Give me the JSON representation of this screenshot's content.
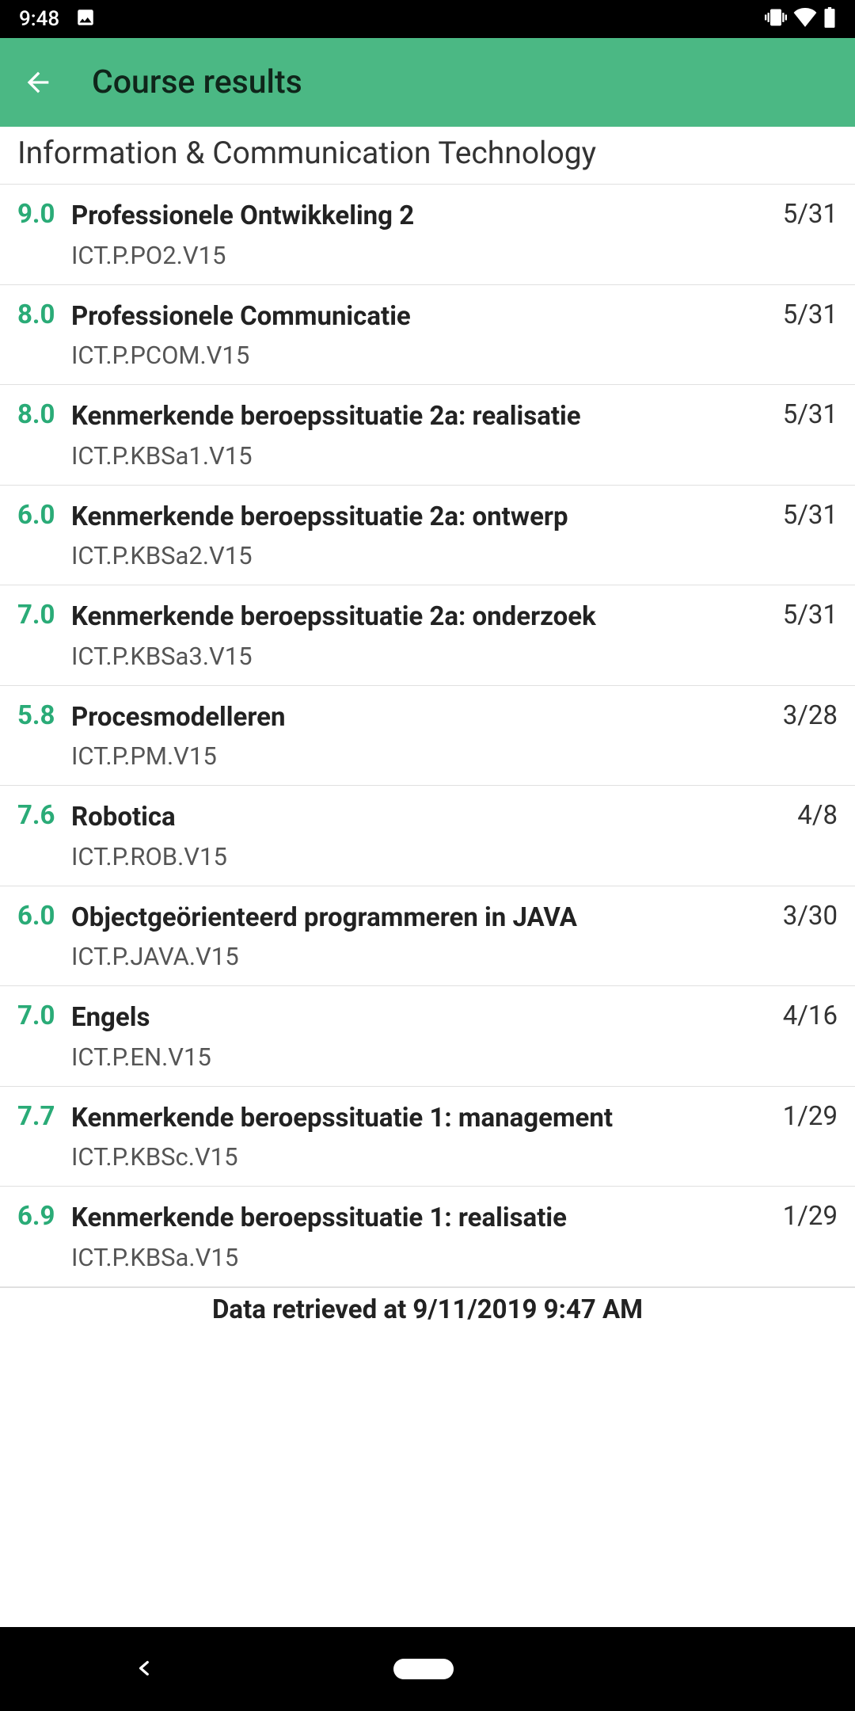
{
  "status": {
    "time": "9:48"
  },
  "appbar": {
    "title": "Course results"
  },
  "section": {
    "header": "Information & Communication Technology"
  },
  "courses": [
    {
      "grade": "9.0",
      "name": "Professionele Ontwikkeling 2",
      "code": "ICT.P.PO2.V15",
      "date": "5/31"
    },
    {
      "grade": "8.0",
      "name": "Professionele Communicatie",
      "code": "ICT.P.PCOM.V15",
      "date": "5/31"
    },
    {
      "grade": "8.0",
      "name": "Kenmerkende beroepssituatie 2a: realisatie",
      "code": "ICT.P.KBSa1.V15",
      "date": "5/31"
    },
    {
      "grade": "6.0",
      "name": "Kenmerkende beroepssituatie 2a: ontwerp",
      "code": "ICT.P.KBSa2.V15",
      "date": "5/31"
    },
    {
      "grade": "7.0",
      "name": "Kenmerkende beroepssituatie 2a: onderzoek",
      "code": "ICT.P.KBSa3.V15",
      "date": "5/31"
    },
    {
      "grade": "5.8",
      "name": "Procesmodelleren",
      "code": "ICT.P.PM.V15",
      "date": "3/28"
    },
    {
      "grade": "7.6",
      "name": "Robotica",
      "code": "ICT.P.ROB.V15",
      "date": "4/8"
    },
    {
      "grade": "6.0",
      "name": "Objectgeörienteerd programmeren in JAVA",
      "code": "ICT.P.JAVA.V15",
      "date": "3/30"
    },
    {
      "grade": "7.0",
      "name": "Engels",
      "code": "ICT.P.EN.V15",
      "date": "4/16"
    },
    {
      "grade": "7.7",
      "name": "Kenmerkende beroepssituatie 1: management",
      "code": "ICT.P.KBSc.V15",
      "date": "1/29"
    },
    {
      "grade": "6.9",
      "name": "Kenmerkende beroepssituatie 1: realisatie",
      "code": "ICT.P.KBSa.V15",
      "date": "1/29"
    }
  ],
  "footer": {
    "text": "Data retrieved at 9/11/2019 9:47 AM"
  }
}
